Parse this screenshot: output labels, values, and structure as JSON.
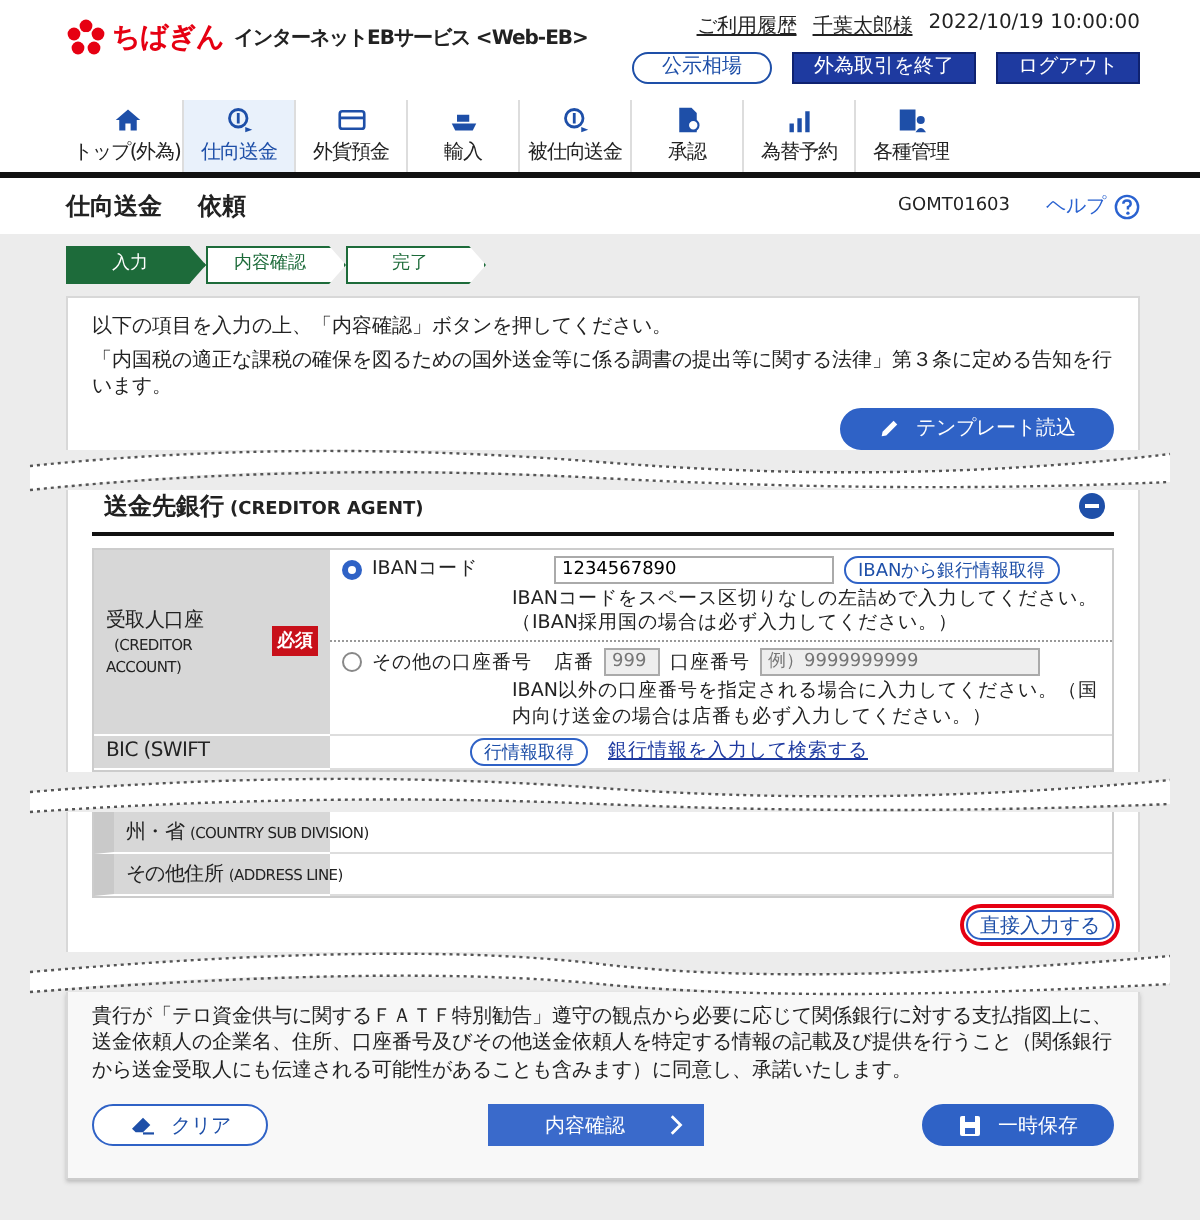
{
  "header": {
    "logo_text": "ちばぎん",
    "service_name": "インターネットEBサービス <Web-EB>",
    "links": [
      "ご利用履歴",
      "千葉太郎様"
    ],
    "datetime": "2022/10/19 10:00:00",
    "buttons": [
      {
        "label": "公示相場",
        "kind": "outline"
      },
      {
        "label": "外為取引を終了",
        "kind": "solid"
      },
      {
        "label": "ログアウト",
        "kind": "solid"
      }
    ]
  },
  "nav": [
    {
      "label": "トップ(外為)",
      "selected": false
    },
    {
      "label": "仕向送金",
      "selected": true
    },
    {
      "label": "外貨預金",
      "selected": false
    },
    {
      "label": "輸入",
      "selected": false
    },
    {
      "label": "被仕向送金",
      "selected": false
    },
    {
      "label": "承認",
      "selected": false
    },
    {
      "label": "為替予約",
      "selected": false
    },
    {
      "label": "各種管理",
      "selected": false
    }
  ],
  "page_title": {
    "title": "仕向送金",
    "subtitle": "依頼",
    "screen_id": "GOMT01603",
    "help": "ヘルプ"
  },
  "steps": [
    {
      "label": "入力",
      "selected": true
    },
    {
      "label": "内容確認",
      "selected": false
    },
    {
      "label": "完了",
      "selected": false
    }
  ],
  "intro": [
    "以下の項目を入力の上、「内容確認」ボタンを押してください。",
    "「内国税の適正な課税の確保を図るための国外送金等に係る調書の提出等に関する法律」第３条に定める告知を行います。"
  ],
  "template_button": "テンプレート読込",
  "section": {
    "title": "送金先銀行",
    "title_en": "(CREDITOR AGENT)",
    "expanded": true
  },
  "account": {
    "label": "受取人口座",
    "label_en": "(CREDITOR ACCOUNT)",
    "required_badge": "必須",
    "options": [
      {
        "kind": "iban",
        "label": "IBANコード",
        "selected": true,
        "value": "1234567890",
        "button": "IBANから銀行情報取得",
        "help": "IBANコードをスペース区切りなしの左詰めで入力してください。（IBAN採用国の場合は必ず入力してください。）"
      },
      {
        "kind": "other",
        "label": "その他の口座番号",
        "selected": false,
        "branch_label": "店番",
        "branch_value": "999",
        "account_label": "口座番号",
        "account_placeholder": "例）9999999999",
        "help": "IBAN以外の口座番号を指定される場合に入力してください。（国内向け送金の場合は店番も必ず入力してください。）"
      }
    ]
  },
  "bic_row": {
    "label": "BIC (SWIFT",
    "button": "行情報取得",
    "link": "銀行情報を入力して検索する"
  },
  "address_rows": [
    {
      "label": "州・省",
      "label_en": "(COUNTRY SUB DIVISION)"
    },
    {
      "label": "その他住所",
      "label_en": "(ADDRESS LINE)"
    }
  ],
  "direct_input_button": "直接入力する",
  "consent": "貴行が「テロ資金供与に関するＦＡＴＦ特別勧告」遵守の観点から必要に応じて関係銀行に対する支払指図上に、送金依頼人の企業名、住所、口座番号及びその他送金依頼人を特定する情報の記載及び提供を行うこと（関係銀行から送金受取人にも伝達される可能性があることも含みます）に同意し、承諾いたします。",
  "footer_buttons": {
    "clear": "クリア",
    "confirm": "内容確認",
    "save": "一時保存"
  }
}
